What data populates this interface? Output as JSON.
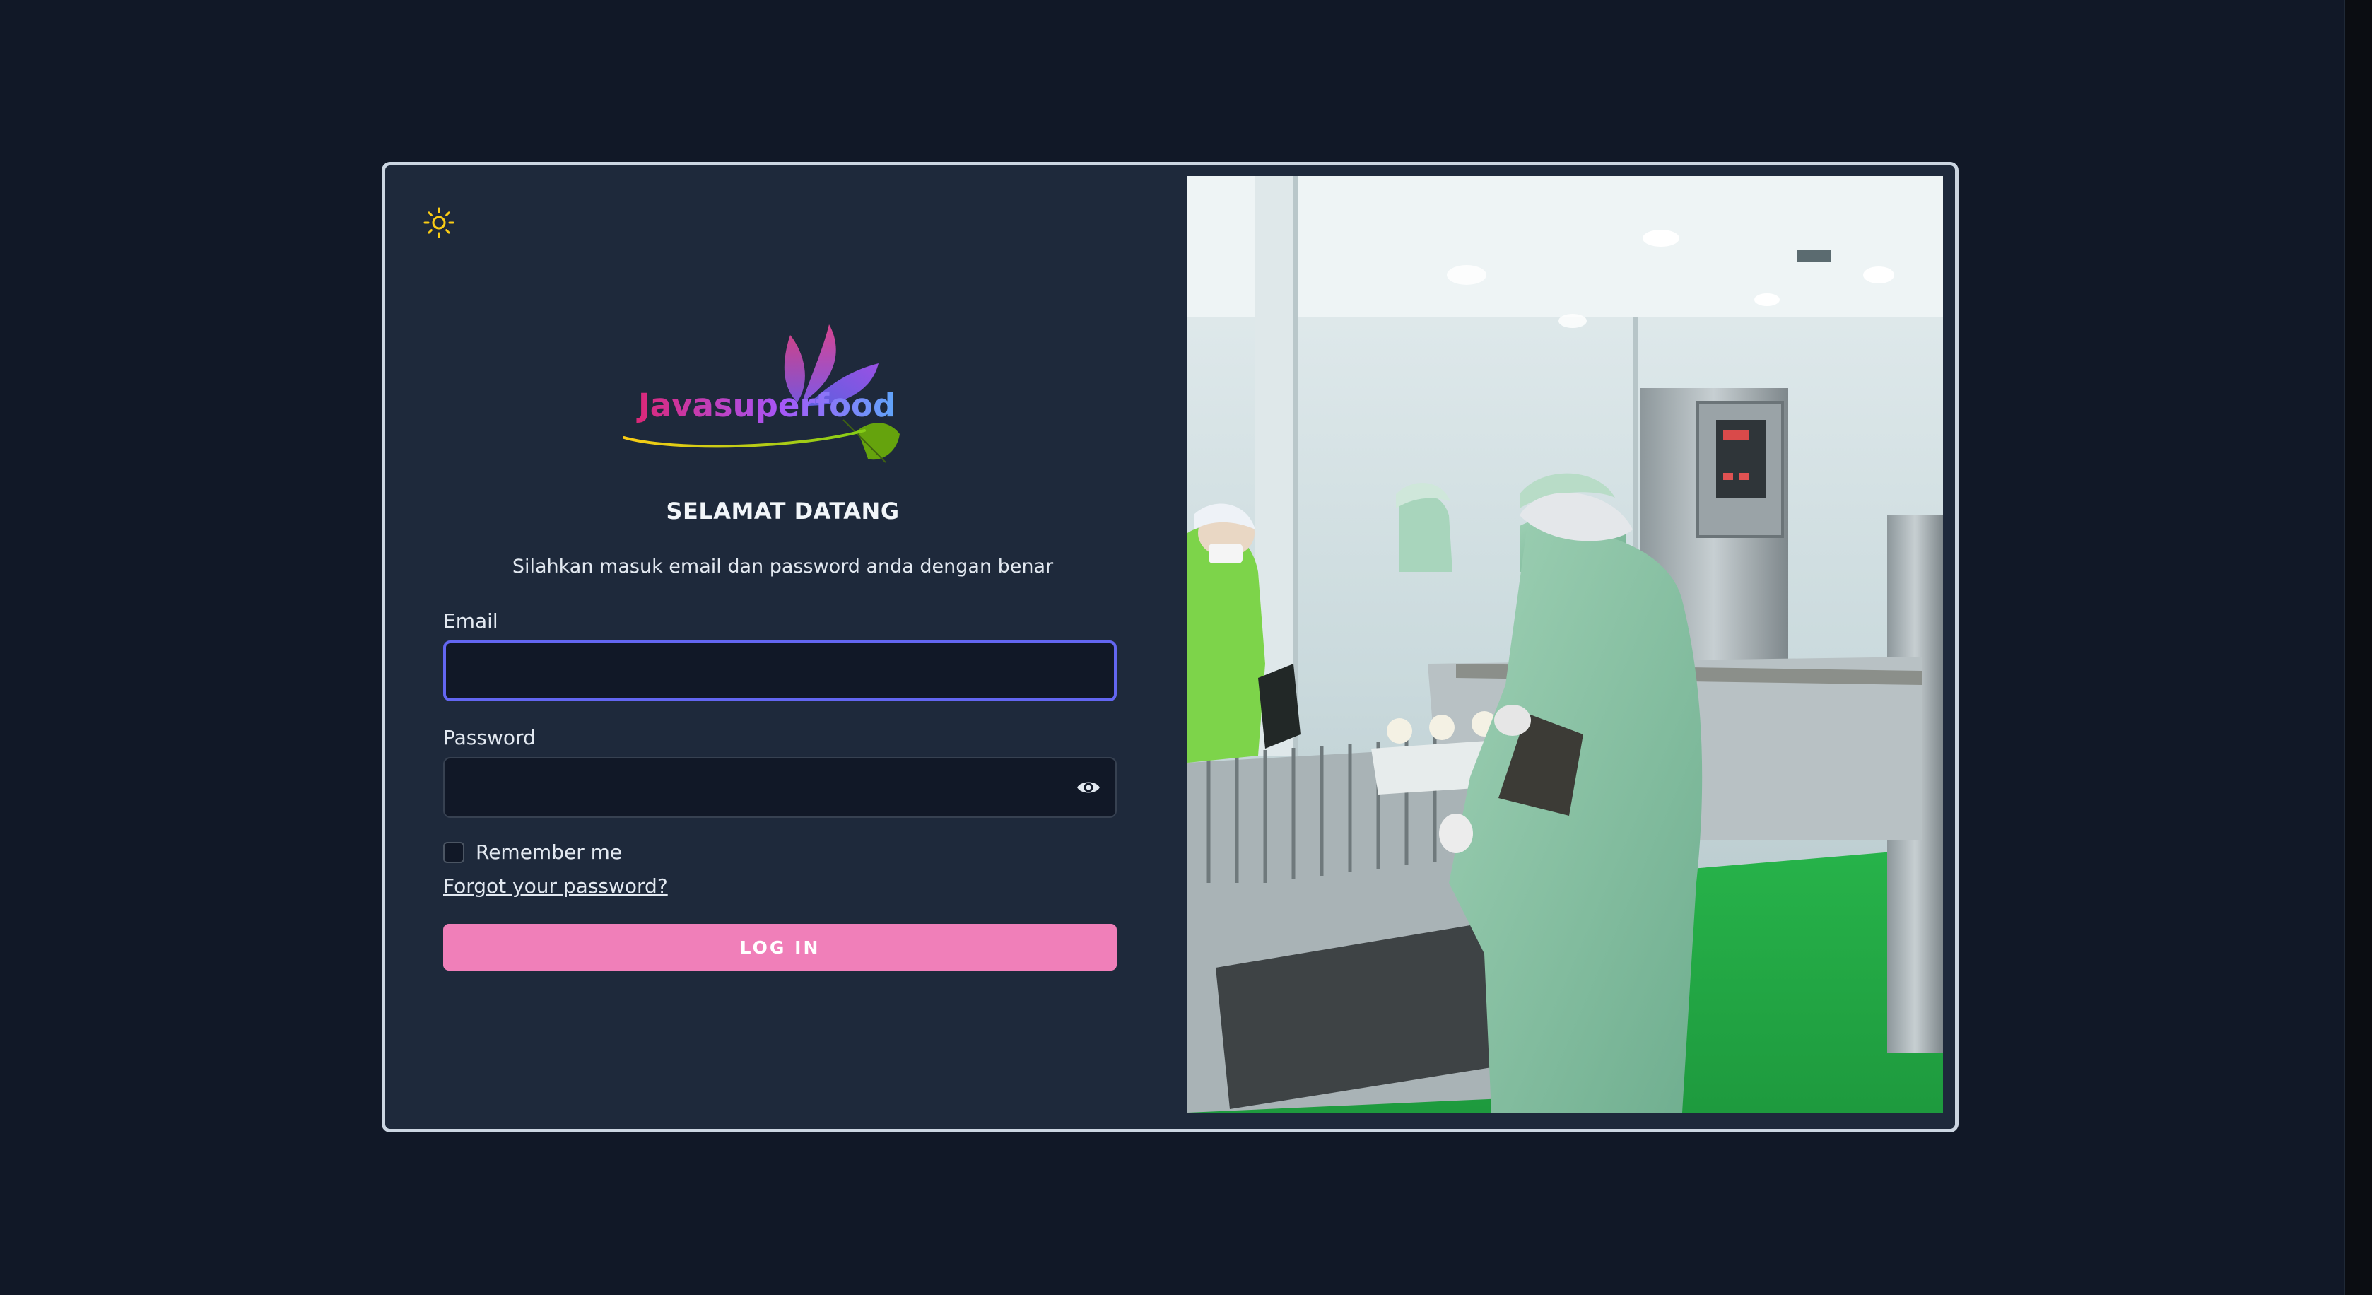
{
  "theme_toggle": {
    "icon": "sun-icon",
    "color": "#facc15"
  },
  "logo": {
    "text": "Javasuperfood"
  },
  "login": {
    "heading": "SELAMAT DATANG",
    "subtitle": "Silahkan masuk email dan password anda dengan benar",
    "email_label": "Email",
    "email_value": "",
    "password_label": "Password",
    "password_value": "",
    "remember_label": "Remember me",
    "remember_checked": false,
    "forgot_link": "Forgot your password?",
    "submit_label": "LOG IN"
  },
  "colors": {
    "background": "#111827",
    "card": "#1e293b",
    "input": "#111827",
    "focus_ring": "#6366f1",
    "primary_button": "#f07fb9",
    "text": "#e2e8f0"
  }
}
